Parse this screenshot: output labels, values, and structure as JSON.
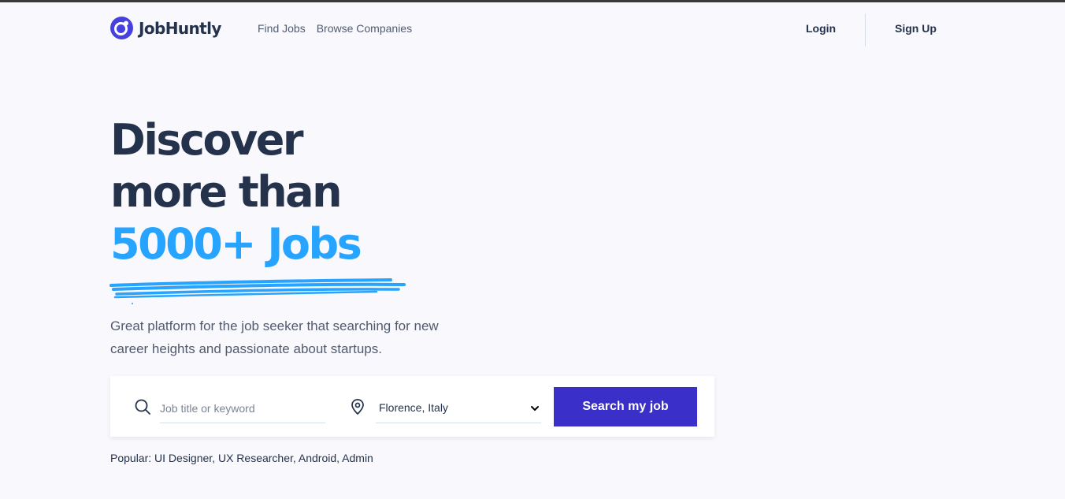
{
  "brand": {
    "name": "JobHuntly",
    "color": "#4640de"
  },
  "nav": {
    "links": [
      "Find Jobs",
      "Browse Companies"
    ],
    "login_label": "Login",
    "signup_label": "Sign Up"
  },
  "hero": {
    "line1": "Discover",
    "line2": "more than",
    "highlight": "5000+ Jobs",
    "subtitle": "Great platform for the job seeker that searching for new career heights and passionate about startups.",
    "accent_color": "#26a4ff"
  },
  "search": {
    "keyword_placeholder": "Job title or keyword",
    "keyword_value": "",
    "location_value": "Florence, Italy",
    "button_label": "Search my job",
    "icons": [
      "search-icon",
      "location-pin-icon",
      "chevron-down-icon"
    ],
    "button_color": "#3b2fc9"
  },
  "popular": {
    "text": "Popular: UI Designer, UX Researcher, Android, Admin"
  }
}
